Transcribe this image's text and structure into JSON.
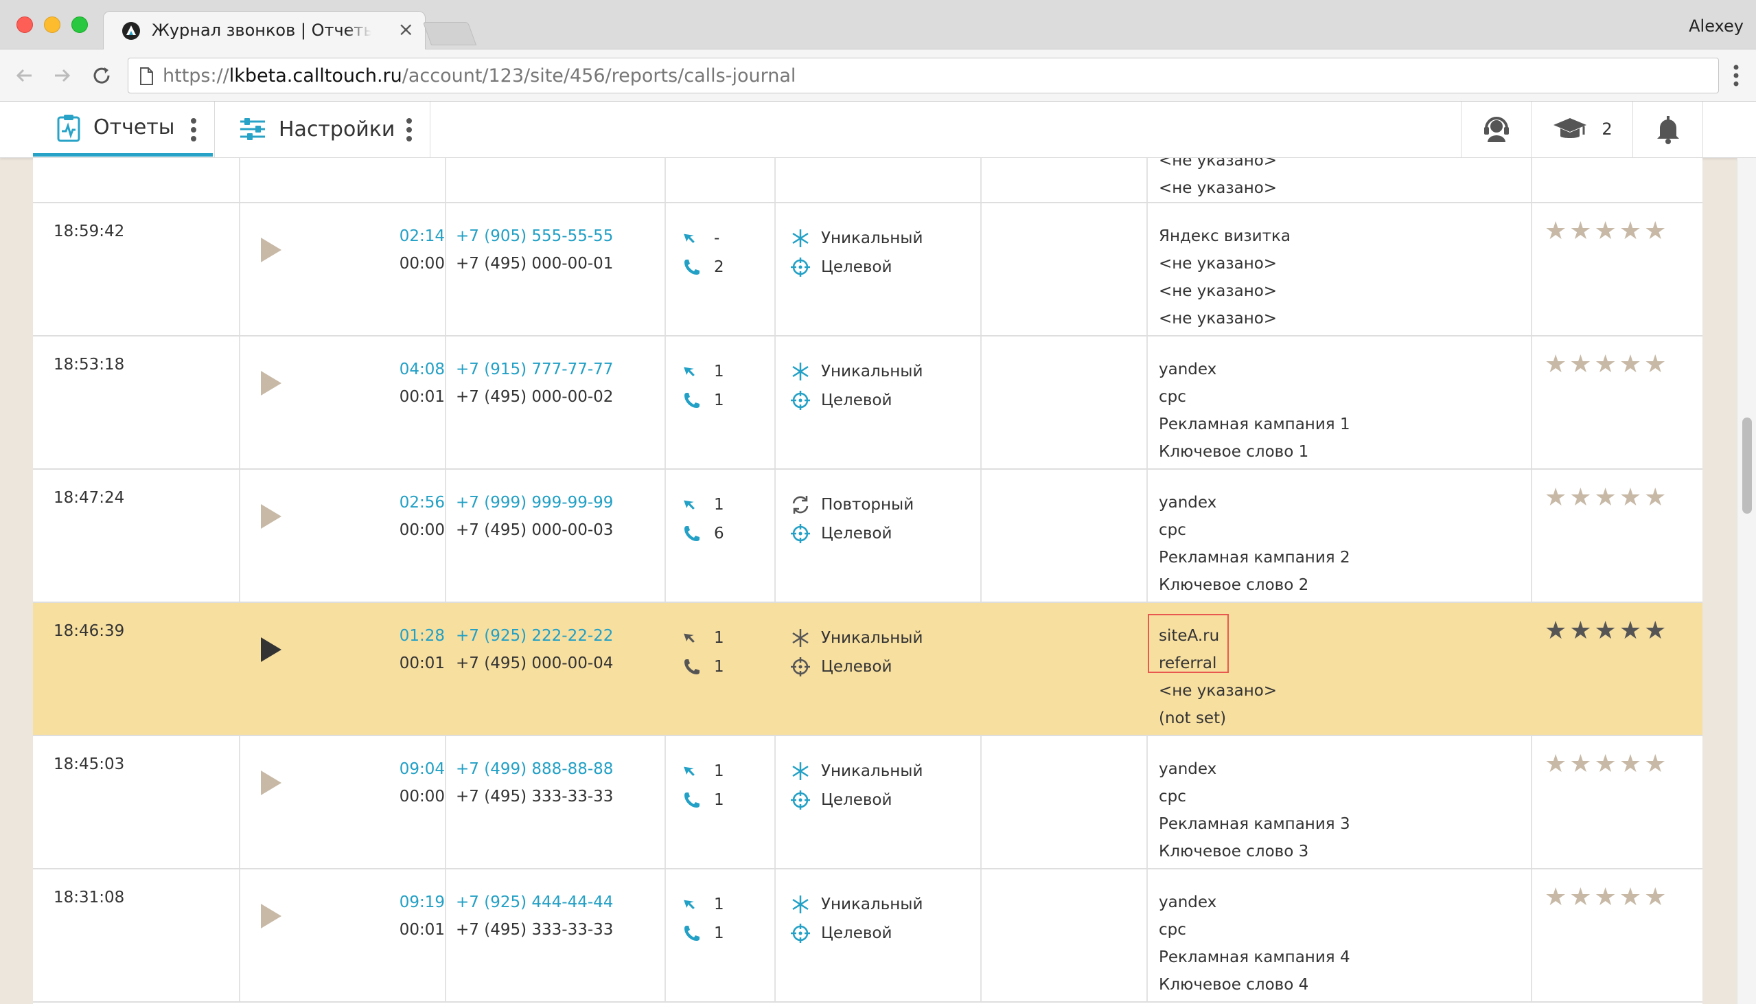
{
  "browser": {
    "tab_title": "Журнал звонков | Отчеты | Calltouch",
    "profile": "Alexey",
    "url_scheme": "https://",
    "url_host": "lkbeta.calltouch.ru",
    "url_path": "/account/123/site/456/reports/calls-journal"
  },
  "header": {
    "tabs": [
      {
        "label": "Отчеты"
      },
      {
        "label": "Настройки"
      }
    ],
    "edu_count": "2"
  },
  "top_partial": {
    "source": [
      "<не указано>",
      "<не указано>"
    ]
  },
  "rows": [
    {
      "time": "18:59:42",
      "talk": "02:14",
      "wait": "00:00",
      "caller": "+7 (905) 555-55-55",
      "callee": "+7 (495) 000-00-01",
      "visits": "-",
      "calls": "2",
      "tag1": "Уникальный",
      "tag2": "Целевой",
      "source": [
        "Яндекс визитка",
        "<не указано>",
        "<не указано>",
        "<не указано>"
      ],
      "rating": "★★★★★"
    },
    {
      "time": "18:53:18",
      "talk": "04:08",
      "wait": "00:01",
      "caller": "+7 (915) 777-77-77",
      "callee": "+7 (495) 000-00-02",
      "visits": "1",
      "calls": "1",
      "tag1": "Уникальный",
      "tag2": "Целевой",
      "source": [
        "yandex",
        "cpc",
        "Рекламная кампания 1",
        "Ключевое слово 1"
      ],
      "rating": "★★★★★"
    },
    {
      "time": "18:47:24",
      "talk": "02:56",
      "wait": "00:00",
      "caller": "+7 (999) 999-99-99",
      "callee": "+7 (495) 000-00-03",
      "visits": "1",
      "calls": "6",
      "tag1": "Повторный",
      "tag2": "Целевой",
      "source": [
        "yandex",
        "cpc",
        "Рекламная кампания 2",
        "Ключевое слово 2"
      ],
      "rating": "★★★★★"
    },
    {
      "time": "18:46:39",
      "talk": "01:28",
      "wait": "00:01",
      "caller": "+7 (925) 222-22-22",
      "callee": "+7 (495) 000-00-04",
      "visits": "1",
      "calls": "1",
      "tag1": "Уникальный",
      "tag2": "Целевой",
      "source": [
        "siteA.ru",
        "referral",
        "<не указано>",
        "(not set)"
      ],
      "rating": "★★★★★"
    },
    {
      "time": "18:45:03",
      "talk": "09:04",
      "wait": "00:00",
      "caller": "+7 (499) 888-88-88",
      "callee": "+7 (495) 333-33-33",
      "visits": "1",
      "calls": "1",
      "tag1": "Уникальный",
      "tag2": "Целевой",
      "source": [
        "yandex",
        "cpc",
        "Рекламная кампания 3",
        "Ключевое слово 3"
      ],
      "rating": "★★★★★"
    },
    {
      "time": "18:31:08",
      "talk": "09:19",
      "wait": "00:01",
      "caller": "+7 (925) 444-44-44",
      "callee": "+7 (495) 333-33-33",
      "visits": "1",
      "calls": "1",
      "tag1": "Уникальный",
      "tag2": "Целевой",
      "source": [
        "yandex",
        "cpc",
        "Рекламная кампания 4",
        "Ключевое слово 4"
      ],
      "rating": "★★★★★"
    }
  ],
  "highlight_row": 3,
  "colors": {
    "accent": "#22a0c5",
    "highlight": "#f7dfa0",
    "annotation_box": "#e8584f"
  }
}
